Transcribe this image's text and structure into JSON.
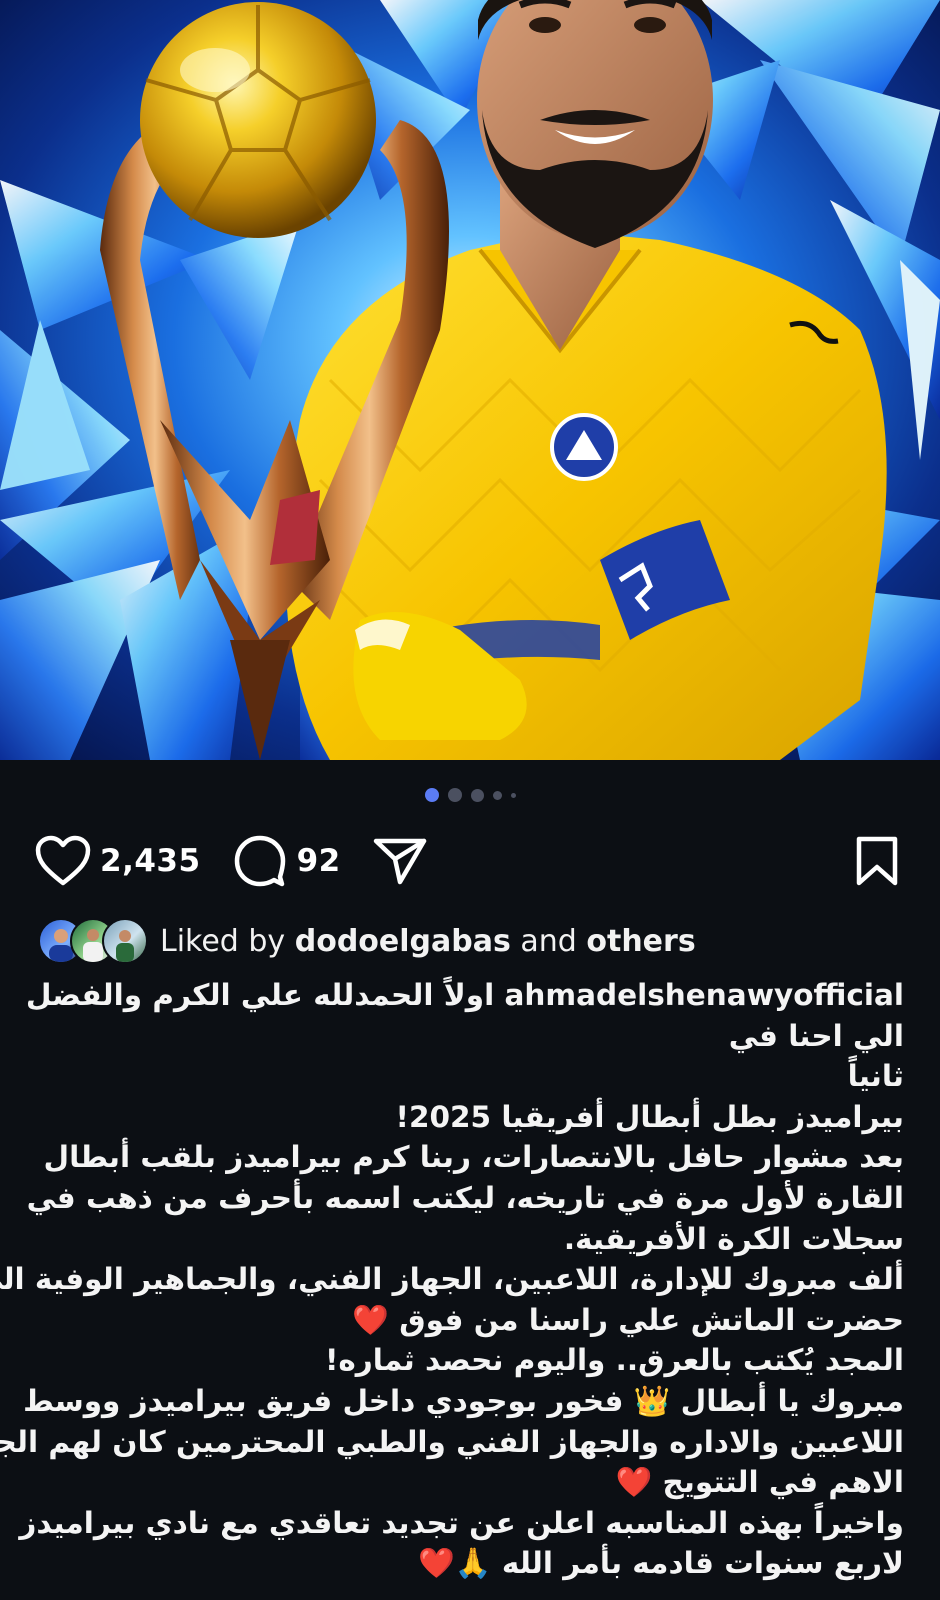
{
  "post": {
    "image_alt_icon": "player-trophy-photo",
    "carousel": {
      "count": 5,
      "active_index": 0
    },
    "actions": {
      "likes": "2,435",
      "comments": "92"
    },
    "liked_by": {
      "prefix": "Liked by",
      "user": "dodoelgabas",
      "connector": "and",
      "suffix": "others"
    },
    "caption": {
      "username": "ahmadelshenawyofficial",
      "first_line_text": " اولاً الحمدلله علي الكرم والفضل",
      "lines": [
        "الي احنا في",
        "ثانياً",
        "بيراميدز بطل أبطال أفريقيا 2025!",
        "بعد مشوار حافل بالانتصارات، ربنا كرم  بيراميدز بلقب أبطال",
        "القارة لأول مرة في تاريخه، ليكتب اسمه بأحرف من ذهب في",
        "سجلات الكرة الأفريقية.",
        "ألف مبروك للإدارة، اللاعبين، الجهاز الفني، والجماهير الوفية  الي",
        "حضرت الماتش  علي راسنا من فوق ❤️",
        "المجد يُكتب بالعرق.. واليوم نحصد ثماره!",
        "مبروك يا أبطال 👑  فخور بوجودي داخل فريق بيراميدز  ووسط",
        "اللاعبين والاداره والجهاز الفني والطبي المحترمين  كان لهم الجزء",
        "الاهم في التتويج ❤️",
        "واخيراً بهذه المناسبه اعلن عن تجديد تعاقدي مع نادي بيراميدز",
        "لاربع سنوات قادمه  بأمر الله 🙏❤️"
      ]
    }
  },
  "colors": {
    "background": "#0c0f14",
    "text": "#ffffff",
    "dot_active": "#5b7cf5",
    "dot_inactive": "#4b5060",
    "jersey": "#f5c400",
    "heart": "#e0162b"
  }
}
